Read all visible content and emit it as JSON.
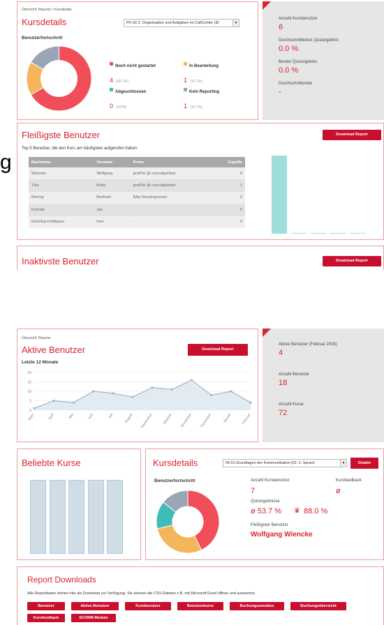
{
  "top": {
    "breadcrumb": "Übersicht: Reports > Kursdetails",
    "kursdetails": {
      "title": "Kursdetails",
      "course_select": "FK-02.2: Organisation und Aufgaben im CallCenter (ID",
      "progress_title": "Benutzerfortschritt",
      "legend": [
        {
          "label": "Noch nicht gestartet",
          "value": "4",
          "pct": "(66.7%)",
          "color": "#f04e58"
        },
        {
          "label": "In Bearbeitung",
          "value": "1",
          "pct": "(16.7%)",
          "color": "#f5b55a"
        },
        {
          "label": "Abgeschlossen",
          "value": "0",
          "pct": "(0.0%)",
          "color": "#3dbdb5"
        },
        {
          "label": "Kein Reporting",
          "value": "1",
          "pct": "(16.7%)",
          "color": "#9aa5b8"
        }
      ],
      "pie": [
        66.7,
        16.7,
        0.0,
        16.7
      ]
    },
    "stats": [
      {
        "label": "Anzahl Kursbenutzer",
        "value": "6"
      },
      {
        "label": "Durchschnittliches Quizergebnis",
        "value": "0.0 %"
      },
      {
        "label": "Bestes Quizergebnis",
        "value": "0.0 %"
      },
      {
        "label": "Durchschnittsnote",
        "value": "-"
      }
    ],
    "fleissigste": {
      "title": "Fleißigste Benutzer",
      "download": "Download Report",
      "subtitle": "Top 5 Benutzer, die den Kurs am häufigsten aufgerufen haben.",
      "columns": [
        "Nachname",
        "Vorname",
        "Firma",
        "Zugriffe"
      ],
      "rows": [
        [
          "Wiencke",
          "Wolfgang",
          "profiTel @ consultpartner",
          "5"
        ],
        [
          "Türy",
          "Britta",
          "profiTel @ consultpartner",
          "1"
        ],
        [
          "Riering",
          "Berthold",
          "RAe Henningsmeier",
          "0"
        ],
        [
          "Kotrade",
          "Jan",
          "-",
          "0"
        ],
        [
          "Gehrling-Feldbauer",
          "Ines",
          "-",
          "0"
        ]
      ],
      "bars": [
        5,
        0,
        0,
        0,
        0
      ]
    },
    "inaktivste": {
      "title": "Inaktivste Benutzer",
      "download": "Download Report"
    }
  },
  "bottom": {
    "breadcrumb": "Übersicht: Reports",
    "aktive": {
      "title": "Aktive Benutzer",
      "download": "Download Report",
      "subtitle": "Letzte 12 Monate"
    },
    "stats": [
      {
        "label": "Aktive Benutzer (Februar 2016)",
        "value": "4"
      },
      {
        "label": "Anzahl Benutzer",
        "value": "18"
      },
      {
        "label": "Anzahl Kurse",
        "value": "72"
      }
    ],
    "beliebte": {
      "title": "Beliebte Kurse",
      "bars": [
        1,
        1,
        1,
        1,
        1
      ]
    },
    "kursdetails2": {
      "title": "Kursdetails",
      "course_select": "IN-01:Grundlagen der Kommunikation (ID: 1; Sprach",
      "details_button": "Details",
      "progress_title": "Benutzerfortschritt",
      "anzahl_label": "Anzahl Kursbenutzer",
      "anzahl_value": "7",
      "feedback_label": "Kursfeedback",
      "feedback_value": "ø",
      "quiz_label": "Quizergebnisse",
      "quiz_avg": "ø 53.7 %",
      "quiz_best": "88.0 %",
      "fleissig_label": "Fleißigster Benutzer",
      "fleissig_value": "Wolfgang Wiencke",
      "pie": [
        42.9,
        28.6,
        14.3,
        14.3
      ],
      "pie_colors": [
        "#f04e58",
        "#f5b55a",
        "#3dbdb5",
        "#9aa5b8"
      ]
    },
    "downloads": {
      "title": "Report Downloads",
      "text": "Alle Reportdaten stehen hier als Download zur Verfügung. Sie können die CSV-Dateien z.B. mit Microsoft Excel öffnen und auswerten.",
      "buttons": [
        "Benutzer",
        "Aktive Benutzer",
        "Kursbenutzer",
        "Benutzerkurse",
        "Buchungsumsätze",
        "Buchungsübersicht",
        "Kursfeedback",
        "SCORM-Module"
      ]
    }
  },
  "chart_data": {
    "type": "line",
    "title": "",
    "categories": [
      "März",
      "April",
      "Mai",
      "Juni",
      "Juli",
      "August",
      "September",
      "Oktober",
      "November",
      "Dezember",
      "Januar",
      "Februar"
    ],
    "values": [
      1,
      5,
      4,
      10,
      9,
      7,
      12,
      11,
      16,
      8,
      10,
      4
    ],
    "ylim": [
      0,
      20
    ],
    "yticks": [
      0,
      5,
      10,
      15,
      20
    ],
    "grid": true
  },
  "colors": {
    "accent": "#d9232d",
    "button": "#c8102e",
    "panel": "#e6e6e6"
  }
}
